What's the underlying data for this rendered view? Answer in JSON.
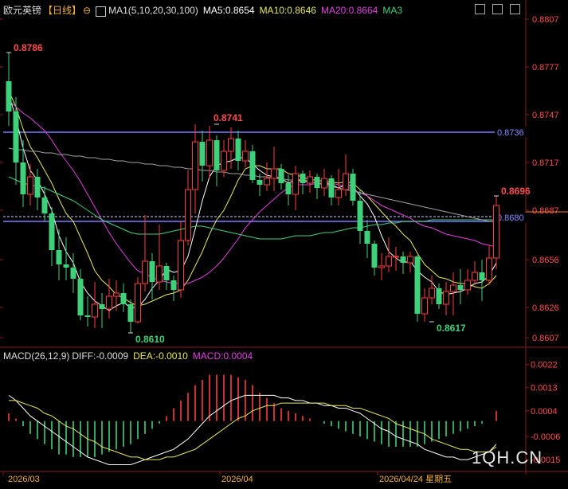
{
  "header": {
    "symbol": "欧元英镑",
    "period": "【日线】",
    "ma_set": "MA1(5,10,20,30,100)",
    "ma5": "MA5:0.8654",
    "ma10": "MA10:0.8646",
    "ma20": "MA20:0.8664",
    "ma3": "MA3",
    "macd_params": "MACD(26,12,9)",
    "diff": "DIFF:-0.0009",
    "dea": "DEA:-0.0010",
    "macd": "MACD:0.0004"
  },
  "colors": {
    "up": "#ff3b3b",
    "down": "#3fd17a",
    "ma5": "#ffffff",
    "ma10": "#e8e85a",
    "ma20": "#e040e0",
    "ma30": "#3fd17a",
    "ma100": "#a0a0a0",
    "hline": "#7a7aff"
  },
  "axis": {
    "price_ticks": [
      "0.8807",
      "0.8777",
      "0.8747",
      "0.8717",
      "0.8687",
      "0.8656",
      "0.8626",
      "0.8607"
    ],
    "macd_ticks": [
      "0.0022",
      "0.0013",
      "0.0004",
      "-0.0006",
      "-0.0015"
    ],
    "dates": [
      "2026/03",
      "2026/04",
      "2026/04/24 星期五"
    ]
  },
  "annotations": {
    "high1": "0.8786",
    "high2": "0.8741",
    "low1": "0.8610",
    "low2": "0.8617",
    "last_high": "0.8696",
    "hline_top": "0.8736",
    "hline_mid": "0.8680"
  },
  "watermark": "1QH.CN",
  "chart_data": {
    "type": "candlestick",
    "price_range": [
      0.8603,
      0.881
    ],
    "candles": [
      [
        0.8768,
        0.8749,
        0.8786,
        0.874
      ],
      [
        0.8749,
        0.8717,
        0.8758,
        0.8703
      ],
      [
        0.8717,
        0.8697,
        0.8731,
        0.8689
      ],
      [
        0.8697,
        0.8708,
        0.8716,
        0.869
      ],
      [
        0.8708,
        0.8695,
        0.8713,
        0.8687
      ],
      [
        0.8695,
        0.8685,
        0.8702,
        0.868
      ],
      [
        0.8685,
        0.8662,
        0.8689,
        0.8652
      ],
      [
        0.8662,
        0.8653,
        0.8675,
        0.8643
      ],
      [
        0.8653,
        0.8651,
        0.867,
        0.8643
      ],
      [
        0.8651,
        0.8644,
        0.866,
        0.8635
      ],
      [
        0.8644,
        0.8621,
        0.865,
        0.8618
      ],
      [
        0.8621,
        0.862,
        0.8633,
        0.8614
      ],
      [
        0.862,
        0.8628,
        0.8642,
        0.8613
      ],
      [
        0.8628,
        0.8625,
        0.8635,
        0.8613
      ],
      [
        0.8625,
        0.8633,
        0.8644,
        0.8619
      ],
      [
        0.8633,
        0.8635,
        0.8643,
        0.8624
      ],
      [
        0.8635,
        0.8628,
        0.8641,
        0.8623
      ],
      [
        0.8628,
        0.8617,
        0.8631,
        0.861
      ],
      [
        0.8617,
        0.8641,
        0.8645,
        0.8616
      ],
      [
        0.8641,
        0.8655,
        0.8684,
        0.8636
      ],
      [
        0.8655,
        0.8642,
        0.866,
        0.8631
      ],
      [
        0.8642,
        0.8652,
        0.8678,
        0.8637
      ],
      [
        0.8652,
        0.8643,
        0.8654,
        0.8637
      ],
      [
        0.8643,
        0.8637,
        0.8646,
        0.863
      ],
      [
        0.8637,
        0.8668,
        0.868,
        0.8632
      ],
      [
        0.8668,
        0.87,
        0.8712,
        0.8665
      ],
      [
        0.87,
        0.873,
        0.8741,
        0.8685
      ],
      [
        0.873,
        0.8715,
        0.8737,
        0.8705
      ],
      [
        0.8715,
        0.8731,
        0.874,
        0.8707
      ],
      [
        0.8731,
        0.8712,
        0.8734,
        0.8702
      ],
      [
        0.8712,
        0.8724,
        0.8731,
        0.8708
      ],
      [
        0.8724,
        0.8732,
        0.8739,
        0.8713
      ],
      [
        0.8732,
        0.8718,
        0.8737,
        0.8712
      ],
      [
        0.8718,
        0.8724,
        0.8731,
        0.8714
      ],
      [
        0.8724,
        0.8706,
        0.8728,
        0.8704
      ],
      [
        0.8706,
        0.8703,
        0.871,
        0.8696
      ],
      [
        0.8703,
        0.8707,
        0.8717,
        0.8699
      ],
      [
        0.8707,
        0.8713,
        0.8727,
        0.8699
      ],
      [
        0.8713,
        0.8704,
        0.8716,
        0.87
      ],
      [
        0.8704,
        0.8697,
        0.8709,
        0.869
      ],
      [
        0.8697,
        0.871,
        0.8715,
        0.8687
      ],
      [
        0.871,
        0.8704,
        0.8712,
        0.8697
      ],
      [
        0.8704,
        0.8708,
        0.8712,
        0.8698
      ],
      [
        0.8708,
        0.8701,
        0.871,
        0.8694
      ],
      [
        0.8701,
        0.8707,
        0.8713,
        0.8696
      ],
      [
        0.8707,
        0.8695,
        0.8709,
        0.869
      ],
      [
        0.8695,
        0.87,
        0.8713,
        0.869
      ],
      [
        0.87,
        0.871,
        0.8722,
        0.8696
      ],
      [
        0.871,
        0.8693,
        0.8713,
        0.869
      ],
      [
        0.8693,
        0.8674,
        0.87,
        0.8666
      ],
      [
        0.8674,
        0.8666,
        0.8681,
        0.8657
      ],
      [
        0.8666,
        0.8651,
        0.8668,
        0.8646
      ],
      [
        0.8651,
        0.8652,
        0.866,
        0.8643
      ],
      [
        0.8652,
        0.8658,
        0.867,
        0.8648
      ],
      [
        0.8658,
        0.8658,
        0.8664,
        0.8649
      ],
      [
        0.8658,
        0.8654,
        0.8661,
        0.8647
      ],
      [
        0.8654,
        0.8658,
        0.8661,
        0.8648
      ],
      [
        0.8658,
        0.8622,
        0.8659,
        0.8617
      ],
      [
        0.8622,
        0.8632,
        0.8638,
        0.8617
      ],
      [
        0.8632,
        0.8638,
        0.8646,
        0.8628
      ],
      [
        0.8638,
        0.8628,
        0.8641,
        0.8625
      ],
      [
        0.8628,
        0.8636,
        0.8642,
        0.8621
      ],
      [
        0.8636,
        0.864,
        0.8648,
        0.8621
      ],
      [
        0.864,
        0.8637,
        0.865,
        0.8628
      ],
      [
        0.8637,
        0.8643,
        0.865,
        0.8634
      ],
      [
        0.8643,
        0.8648,
        0.8655,
        0.864
      ],
      [
        0.8648,
        0.8643,
        0.8656,
        0.863
      ],
      [
        0.8643,
        0.8657,
        0.8665,
        0.864
      ],
      [
        0.8657,
        0.869,
        0.8696,
        0.865
      ]
    ],
    "series": [
      {
        "name": "MA5",
        "values": [
          0.876,
          0.8745,
          0.8726,
          0.8712,
          0.8706,
          0.8697,
          0.8687,
          0.8671,
          0.8661,
          0.8654,
          0.8642,
          0.8635,
          0.863,
          0.8627,
          0.8624,
          0.8627,
          0.8629,
          0.8626,
          0.8626,
          0.8631,
          0.8638,
          0.8643,
          0.865,
          0.8648,
          0.8649,
          0.8658,
          0.8675,
          0.8693,
          0.8708,
          0.8715,
          0.8717,
          0.8718,
          0.872,
          0.872,
          0.8716,
          0.8712,
          0.8709,
          0.8708,
          0.8707,
          0.8704,
          0.8706,
          0.8706,
          0.8705,
          0.8704,
          0.8704,
          0.8703,
          0.8701,
          0.8703,
          0.8702,
          0.8696,
          0.8691,
          0.8683,
          0.8671,
          0.8661,
          0.8657,
          0.8654,
          0.8655,
          0.8649,
          0.8645,
          0.8642,
          0.8636,
          0.8634,
          0.8635,
          0.8636,
          0.8638,
          0.8641,
          0.8642,
          0.8646,
          0.8654
        ]
      },
      {
        "name": "MA10",
        "values": [
          0.8762,
          0.8752,
          0.8738,
          0.8727,
          0.872,
          0.8712,
          0.8704,
          0.8694,
          0.8685,
          0.868,
          0.867,
          0.866,
          0.8649,
          0.8643,
          0.8639,
          0.8634,
          0.8632,
          0.8629,
          0.8627,
          0.8628,
          0.863,
          0.8632,
          0.8634,
          0.8635,
          0.8637,
          0.8643,
          0.8652,
          0.8661,
          0.8672,
          0.8681,
          0.8687,
          0.8696,
          0.8706,
          0.8713,
          0.8715,
          0.8715,
          0.8713,
          0.8713,
          0.8713,
          0.871,
          0.8709,
          0.8708,
          0.8706,
          0.8706,
          0.8705,
          0.8705,
          0.8704,
          0.8705,
          0.8704,
          0.87,
          0.8696,
          0.8691,
          0.8686,
          0.8681,
          0.8677,
          0.8672,
          0.8668,
          0.866,
          0.8653,
          0.8649,
          0.8645,
          0.8644,
          0.8642,
          0.8641,
          0.8641,
          0.8639,
          0.8638,
          0.8641,
          0.8646
        ]
      },
      {
        "name": "MA20",
        "values": [
          0.8756,
          0.8752,
          0.8748,
          0.8745,
          0.8741,
          0.8737,
          0.8731,
          0.8724,
          0.8718,
          0.8712,
          0.8705,
          0.8697,
          0.8689,
          0.8681,
          0.8673,
          0.8666,
          0.866,
          0.8654,
          0.8649,
          0.8647,
          0.8645,
          0.8643,
          0.8642,
          0.8641,
          0.8641,
          0.8641,
          0.8643,
          0.8645,
          0.8648,
          0.8652,
          0.8657,
          0.8663,
          0.8669,
          0.8676,
          0.8681,
          0.8686,
          0.869,
          0.8694,
          0.8698,
          0.8701,
          0.8703,
          0.8703,
          0.8703,
          0.8704,
          0.8704,
          0.8704,
          0.8703,
          0.8702,
          0.87,
          0.8698,
          0.8696,
          0.8693,
          0.869,
          0.8688,
          0.8686,
          0.8684,
          0.8682,
          0.8679,
          0.8677,
          0.8676,
          0.8674,
          0.8672,
          0.8671,
          0.867,
          0.8669,
          0.8668,
          0.8666,
          0.8665,
          0.8664
        ]
      },
      {
        "name": "MA30",
        "values": [
          0.8708,
          0.8706,
          0.8704,
          0.8703,
          0.8702,
          0.8701,
          0.8699,
          0.8697,
          0.8695,
          0.8693,
          0.869,
          0.8687,
          0.8684,
          0.8681,
          0.8679,
          0.8677,
          0.8675,
          0.8673,
          0.8672,
          0.8672,
          0.8672,
          0.8672,
          0.8673,
          0.8674,
          0.8675,
          0.8676,
          0.8677,
          0.8677,
          0.8676,
          0.8675,
          0.8674,
          0.8673,
          0.8672,
          0.8671,
          0.867,
          0.8669,
          0.8669,
          0.8669,
          0.8669,
          0.867,
          0.8671,
          0.8671,
          0.8671,
          0.8672,
          0.8673,
          0.8673,
          0.8674,
          0.8675,
          0.8676,
          0.8676,
          0.8677,
          0.8678,
          0.8678,
          0.8679,
          0.8679,
          0.868,
          0.868,
          0.868,
          0.868,
          0.8681,
          0.8681,
          0.8681,
          0.8681,
          0.8681,
          0.8681,
          0.8681,
          0.8681,
          0.8681,
          0.8681
        ]
      },
      {
        "name": "MA100",
        "values": [
          0.8726,
          0.8725,
          0.8725,
          0.8724,
          0.8724,
          0.8723,
          0.8723,
          0.8722,
          0.8722,
          0.8721,
          0.8721,
          0.872,
          0.872,
          0.8719,
          0.8719,
          0.8718,
          0.8718,
          0.8717,
          0.8717,
          0.8716,
          0.8716,
          0.8715,
          0.8715,
          0.8714,
          0.8714,
          0.8713,
          0.8713,
          0.8712,
          0.8712,
          0.8711,
          0.8711,
          0.871,
          0.871,
          0.8709,
          0.8709,
          0.8708,
          0.8708,
          0.8707,
          0.8707,
          0.8706,
          0.8706,
          0.8705,
          0.8705,
          0.8704,
          0.8703,
          0.8702,
          0.8701,
          0.87,
          0.8699,
          0.8698,
          0.8697,
          0.8696,
          0.8695,
          0.8694,
          0.8693,
          0.8692,
          0.8691,
          0.869,
          0.8689,
          0.8688,
          0.8687,
          0.8686,
          0.8685,
          0.8684,
          0.8683,
          0.8682,
          0.8681,
          0.868,
          0.868
        ]
      }
    ],
    "hlines": [
      0.8736,
      0.868
    ],
    "dashed_line": 0.8683,
    "macd": {
      "range": [
        -0.0019,
        0.0025
      ],
      "diff": [
        0.001,
        0.0008,
        0.0005,
        0.0002,
        0.0,
        -0.0002,
        -0.0004,
        -0.0006,
        -0.0008,
        -0.001,
        -0.0012,
        -0.0014,
        -0.0015,
        -0.0016,
        -0.0017,
        -0.0017,
        -0.0017,
        -0.0017,
        -0.0016,
        -0.0015,
        -0.0014,
        -0.0013,
        -0.0012,
        -0.0011,
        -0.0009,
        -0.0007,
        -0.0004,
        -0.0001,
        0.0002,
        0.0004,
        0.0006,
        0.0008,
        0.0009,
        0.001,
        0.001,
        0.001,
        0.001,
        0.001,
        0.0009,
        0.0009,
        0.0008,
        0.0008,
        0.0007,
        0.0007,
        0.0006,
        0.0006,
        0.0005,
        0.0005,
        0.0004,
        0.0003,
        0.0001,
        -0.0001,
        -0.0003,
        -0.0004,
        -0.0006,
        -0.0007,
        -0.0008,
        -0.0009,
        -0.0011,
        -0.0012,
        -0.0013,
        -0.0014,
        -0.0014,
        -0.0015,
        -0.0015,
        -0.0014,
        -0.0013,
        -0.0012,
        -0.0009
      ],
      "dea": [
        0.0008,
        0.0008,
        0.0007,
        0.0006,
        0.0005,
        0.0003,
        0.0002,
        0.0,
        -0.0002,
        -0.0003,
        -0.0005,
        -0.0007,
        -0.0008,
        -0.001,
        -0.0011,
        -0.0012,
        -0.0013,
        -0.0014,
        -0.0014,
        -0.0015,
        -0.0015,
        -0.0015,
        -0.0014,
        -0.0014,
        -0.0013,
        -0.0012,
        -0.0011,
        -0.0009,
        -0.0007,
        -0.0005,
        -0.0003,
        -0.0001,
        0.0001,
        0.0002,
        0.0004,
        0.0005,
        0.0006,
        0.0006,
        0.0007,
        0.0007,
        0.0007,
        0.0007,
        0.0007,
        0.0007,
        0.0007,
        0.0006,
        0.0006,
        0.0006,
        0.0005,
        0.0005,
        0.0004,
        0.0003,
        0.0002,
        0.0001,
        -0.0001,
        -0.0002,
        -0.0003,
        -0.0004,
        -0.0005,
        -0.0007,
        -0.0008,
        -0.0009,
        -0.001,
        -0.0011,
        -0.0011,
        -0.0012,
        -0.0012,
        -0.0012,
        -0.001
      ],
      "hist": [
        0.0003,
        0.0001,
        -0.0002,
        -0.0005,
        -0.0007,
        -0.0009,
        -0.0011,
        -0.0013,
        -0.0013,
        -0.0014,
        -0.0014,
        -0.0014,
        -0.0014,
        -0.0013,
        -0.0012,
        -0.0011,
        -0.001,
        -0.0009,
        -0.0007,
        -0.0005,
        -0.0003,
        -0.0001,
        0.0002,
        0.0005,
        0.0008,
        0.0011,
        0.0014,
        0.0016,
        0.0018,
        0.0018,
        0.0018,
        0.0018,
        0.0017,
        0.0016,
        0.0014,
        0.0011,
        0.0009,
        0.0007,
        0.0005,
        0.0004,
        0.0003,
        0.0002,
        0.0001,
        0.0,
        -0.0001,
        -0.0002,
        -0.0003,
        -0.0004,
        -0.0005,
        -0.0006,
        -0.0007,
        -0.0008,
        -0.0009,
        -0.001,
        -0.001,
        -0.001,
        -0.001,
        -0.001,
        -0.0009,
        -0.0008,
        -0.0007,
        -0.0006,
        -0.0005,
        -0.0004,
        -0.0003,
        -0.0002,
        -0.0001,
        0.0,
        0.0004
      ]
    }
  }
}
